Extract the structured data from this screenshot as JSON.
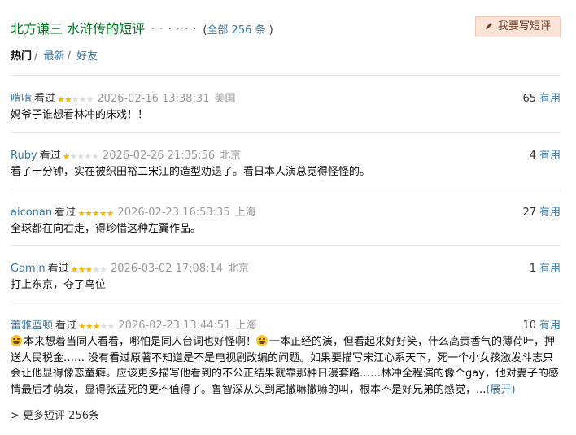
{
  "header": {
    "title": "北方谦三 水浒传的短评",
    "dots": "· · · · · ·",
    "count_open": "(",
    "count_label": "全部 256 条",
    "count_close": ")",
    "write_button": "我要写短评"
  },
  "tabs": [
    {
      "label": "热门",
      "active": true
    },
    {
      "label": "最新",
      "active": false
    },
    {
      "label": "好友",
      "active": false
    }
  ],
  "tab_sep": "/",
  "watched_label": "看过",
  "vote_label": "有用",
  "comments": [
    {
      "user": "啃啃",
      "rating": 2,
      "time": "2026-02-16 13:38:31",
      "location": "美国",
      "votes": "65",
      "text": "妈爷子谁想看林冲的床戏！！"
    },
    {
      "user": "Ruby",
      "rating": 1,
      "time": "2026-02-26 21:35:56",
      "location": "北京",
      "votes": "4",
      "text": "看了十分钟，实在被织田裕二宋江的造型劝退了。看日本人演总觉得怪怪的。"
    },
    {
      "user": "aiconan",
      "rating": 5,
      "time": "2026-02-23 16:53:35",
      "location": "上海",
      "votes": "27",
      "text": "全球都在向右走，得珍惜这种左翼作品。"
    },
    {
      "user": "Gamin",
      "rating": 3,
      "time": "2026-03-02 17:08:14",
      "location": "北京",
      "votes": "1",
      "text": "打上东京，夺了鸟位"
    },
    {
      "user": "蕾雅蓝顿",
      "rating": 3,
      "time": "2026-02-23 13:44:51",
      "location": "上海",
      "votes": "10",
      "text_part1": "本来想着当同人看看，哪怕是同人台词也好怪啊！",
      "text_part2": "一本正经的演，但看起来好好笑，什么高贵香气的薄荷叶，押送人民税金…… 没有看过原著不知道是不是电视剧改编的问题。如果要描写宋江心系天下，死一个小女孩激发斗志只会让他显得像恋童癖。应该更多描写他看到的不公正结果就靠那种日漫套路……林冲全程演的像个gay，他对妻子的感情最后才萌发，显得张蓝死的更不值得了。鲁智深从头到尾撒嘛撒嘛的叫，根本不是好兄弟的感觉，...",
      "expand": "(展开)"
    }
  ],
  "more_link": "> 更多短评 256条"
}
